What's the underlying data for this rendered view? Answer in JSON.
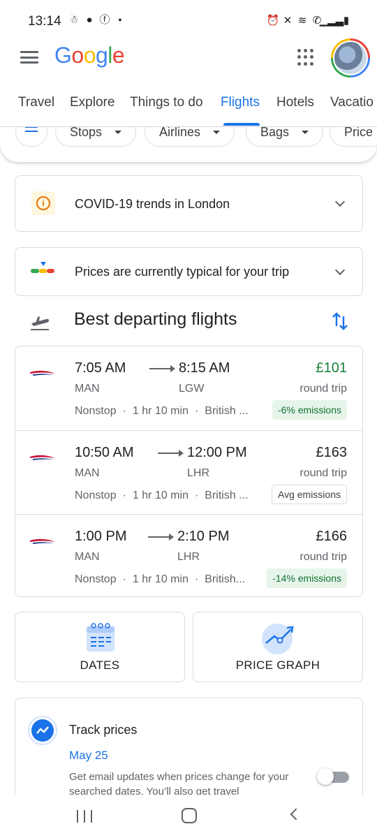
{
  "status_bar": {
    "time": "13:14"
  },
  "header": {
    "logo_letters": [
      "G",
      "o",
      "o",
      "g",
      "l",
      "e"
    ],
    "logo_colors": [
      "#4285f4",
      "#ea4335",
      "#fbbc05",
      "#4285f4",
      "#34a853",
      "#ea4335"
    ]
  },
  "tabs": [
    "Travel",
    "Explore",
    "Things to do",
    "Flights",
    "Hotels",
    "Vacatio"
  ],
  "active_tab": "Flights",
  "filters": [
    "Stops",
    "Airlines",
    "Bags",
    "Price"
  ],
  "info_cards": {
    "covid": "COVID-19 trends in London",
    "prices": "Prices are currently typical for your trip"
  },
  "section_title": "Best departing flights",
  "flights": [
    {
      "depart": "7:05 AM",
      "arrive": "8:15 AM",
      "from": "MAN",
      "to": "LGW",
      "price": "£101",
      "price_note": "round trip",
      "stops": "Nonstop",
      "duration": "1 hr 10 min",
      "airline": "British ...",
      "emissions": "-6% emissions"
    },
    {
      "depart": "10:50 AM",
      "arrive": "12:00 PM",
      "from": "MAN",
      "to": "LHR",
      "price": "£163",
      "price_note": "round trip",
      "stops": "Nonstop",
      "duration": "1 hr 10 min",
      "airline": "British ...",
      "emissions": "Avg emissions"
    },
    {
      "depart": "1:00 PM",
      "arrive": "2:10 PM",
      "from": "MAN",
      "to": "LHR",
      "price": "£166",
      "price_note": "round trip",
      "stops": "Nonstop",
      "duration": "1 hr 10 min",
      "airline": "British...",
      "emissions": "-14% emissions"
    }
  ],
  "tools": {
    "dates": "DATES",
    "price_graph": "PRICE GRAPH"
  },
  "track": {
    "title": "Track prices",
    "date": "May 25",
    "description": "Get email updates when prices change for your searched dates. You’ll also get travel",
    "toggle_on": false
  },
  "colors": {
    "accent": "#1a73e8",
    "green_price": "#188038",
    "emission_good_bg": "#e6f4ea"
  },
  "icons": [
    "menu-icon",
    "apps-grid-icon",
    "info-icon",
    "price-level-icon",
    "chevron-down-icon",
    "departure-plane-icon",
    "sort-icon",
    "airline-logo-icon",
    "calendar-icon",
    "price-graph-icon",
    "trend-icon"
  ]
}
